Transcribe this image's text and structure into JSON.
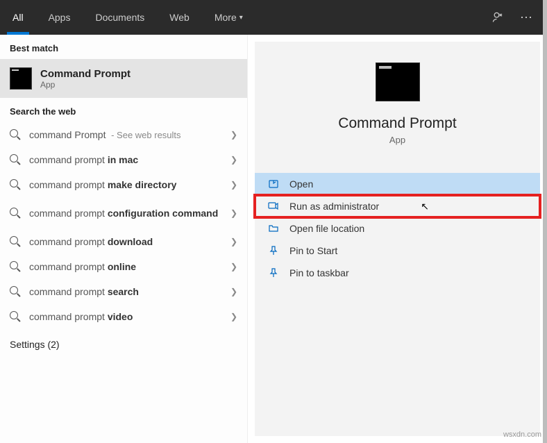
{
  "nav": {
    "tabs": [
      "All",
      "Apps",
      "Documents",
      "Web",
      "More"
    ],
    "activeIndex": 0
  },
  "left": {
    "bestMatchHeader": "Best match",
    "bestMatch": {
      "title": "Command Prompt",
      "subtitle": "App"
    },
    "webHeader": "Search the web",
    "suggestions": [
      {
        "prefix": "command Prompt",
        "bold": "",
        "hint": " - See web results"
      },
      {
        "prefix": "command prompt ",
        "bold": "in mac",
        "hint": ""
      },
      {
        "prefix": "command prompt ",
        "bold": "make directory",
        "hint": ""
      },
      {
        "prefix": "command prompt ",
        "bold": "configuration command",
        "hint": ""
      },
      {
        "prefix": "command prompt ",
        "bold": "download",
        "hint": ""
      },
      {
        "prefix": "command prompt ",
        "bold": "online",
        "hint": ""
      },
      {
        "prefix": "command prompt ",
        "bold": "search",
        "hint": ""
      },
      {
        "prefix": "command prompt ",
        "bold": "video",
        "hint": ""
      }
    ],
    "settingsHeader": "Settings (2)"
  },
  "right": {
    "title": "Command Prompt",
    "subtitle": "App",
    "actions": [
      {
        "label": "Open",
        "state": "selected"
      },
      {
        "label": "Run as administrator",
        "state": "highlighted"
      },
      {
        "label": "Open file location",
        "state": ""
      },
      {
        "label": "Pin to Start",
        "state": ""
      },
      {
        "label": "Pin to taskbar",
        "state": ""
      }
    ]
  },
  "watermark": "wsxdn.com"
}
